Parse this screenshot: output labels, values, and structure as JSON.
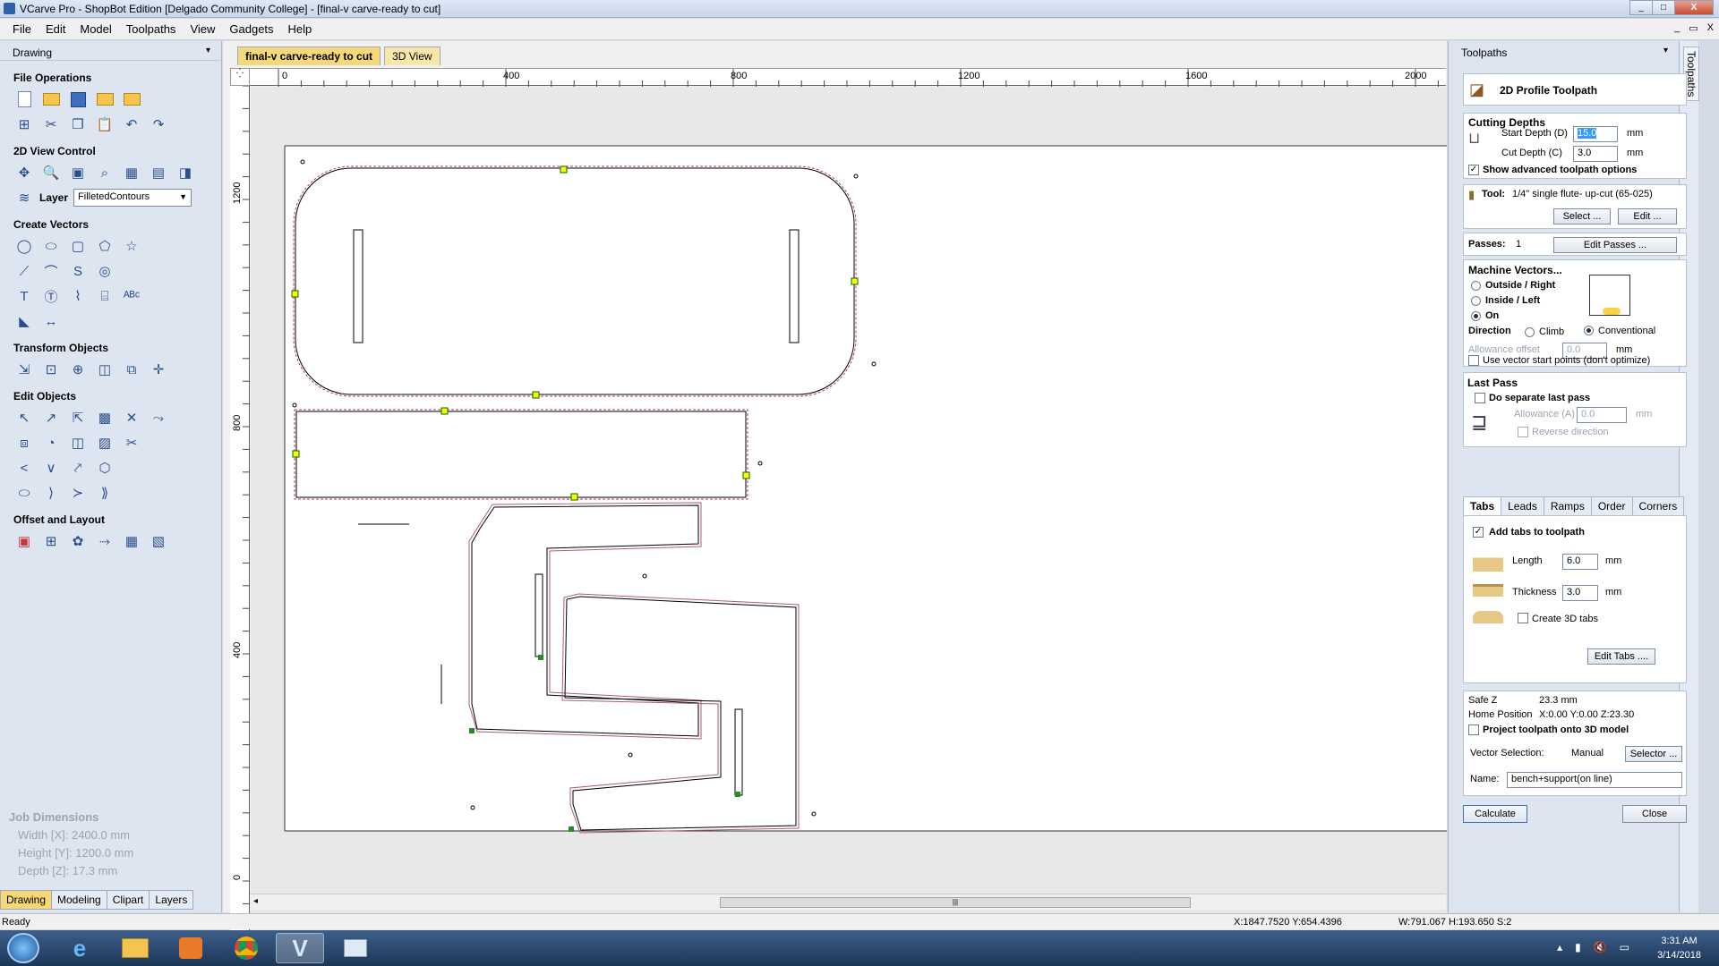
{
  "window": {
    "title": "VCarve Pro - ShopBot Edition [Delgado Community College] - [final-v carve-ready to cut]",
    "controls": [
      "_",
      "□",
      "X"
    ]
  },
  "menu": {
    "items": [
      "File",
      "Edit",
      "Model",
      "Toolpaths",
      "View",
      "Gadgets",
      "Help"
    ],
    "mdi_controls": [
      "_",
      "▭",
      "X"
    ]
  },
  "left_panel": {
    "title": "Drawing",
    "sections": {
      "file_operations": "File Operations",
      "view_control": "2D View Control",
      "layer_label": "Layer",
      "layer_value": "FilletedContours",
      "create_vectors": "Create Vectors",
      "transform_objects": "Transform Objects",
      "edit_objects": "Edit Objects",
      "offset_layout": "Offset and Layout"
    },
    "job_dimensions": {
      "title": "Job Dimensions",
      "width": "Width  [X]: 2400.0 mm",
      "height": "Height [Y]: 1200.0 mm",
      "depth": "Depth  [Z]: 17.3 mm"
    },
    "bottom_tabs": [
      "Drawing",
      "Modeling",
      "Clipart",
      "Layers"
    ]
  },
  "center": {
    "doc_tab": "final-v carve-ready to cut",
    "view3d_tab": "3D View",
    "ruler_top": [
      "0",
      "400",
      "800",
      "1200",
      "1600",
      "2000"
    ],
    "ruler_left": [
      "1200",
      "800",
      "400",
      "0"
    ],
    "scroll_grip": "|||"
  },
  "right_panel": {
    "title": "Toolpaths",
    "side_tab": "Toolpaths",
    "header": "2D Profile Toolpath",
    "cutting_depths": {
      "title": "Cutting Depths",
      "start_label": "Start Depth (D)",
      "start_value": "15.0",
      "cut_label": "Cut Depth (C)",
      "cut_value": "3.0",
      "unit": "mm",
      "advanced": "Show advanced toolpath options"
    },
    "tool": {
      "label": "Tool:",
      "value": "1/4\" single flute- up-cut (65-025)",
      "select_btn": "Select ...",
      "edit_btn": "Edit ..."
    },
    "passes": {
      "label": "Passes:",
      "value": "1",
      "btn": "Edit Passes ..."
    },
    "machine_vectors": {
      "title": "Machine Vectors...",
      "outside": "Outside / Right",
      "inside": "Inside / Left",
      "on": "On",
      "direction": "Direction",
      "climb": "Climb",
      "conventional": "Conventional",
      "allowance_label": "Allowance offset",
      "allowance_value": "0.0",
      "unit": "mm",
      "start_points": "Use vector start points (don't optimize)"
    },
    "last_pass": {
      "title": "Last Pass",
      "separate": "Do separate last pass",
      "allowance_label": "Allowance (A)",
      "allowance_value": "0.0",
      "unit": "mm",
      "reverse": "Reverse direction"
    },
    "tabs": [
      "Tabs",
      "Leads",
      "Ramps",
      "Order",
      "Corners"
    ],
    "tabs_panel": {
      "add": "Add tabs to toolpath",
      "length_label": "Length",
      "length_value": "6.0",
      "thickness_label": "Thickness",
      "thickness_value": "3.0",
      "unit": "mm",
      "create3d": "Create 3D tabs",
      "edit_btn": "Edit Tabs ...."
    },
    "safe": {
      "safe_z_label": "Safe Z",
      "safe_z_value": "23.3 mm",
      "home_label": "Home Position",
      "home_value": "X:0.00 Y:0.00 Z:23.30",
      "project": "Project toolpath onto 3D model",
      "vector_sel_label": "Vector Selection:",
      "vector_sel_value": "Manual",
      "selector_btn": "Selector ...",
      "name_label": "Name:",
      "name_value": "bench+support(on line)"
    },
    "calculate": "Calculate",
    "close": "Close"
  },
  "status": {
    "ready": "Ready",
    "coords": "X:1847.7520 Y:654.4396",
    "size": "W:791.067  H:193.650  S:2"
  },
  "taskbar": {
    "time": "3:31 AM",
    "date": "3/14/2018"
  },
  "colors": {
    "accent_tab": "#f6d87c",
    "toolpath": "#8a2b6b",
    "vector": "#000000"
  }
}
